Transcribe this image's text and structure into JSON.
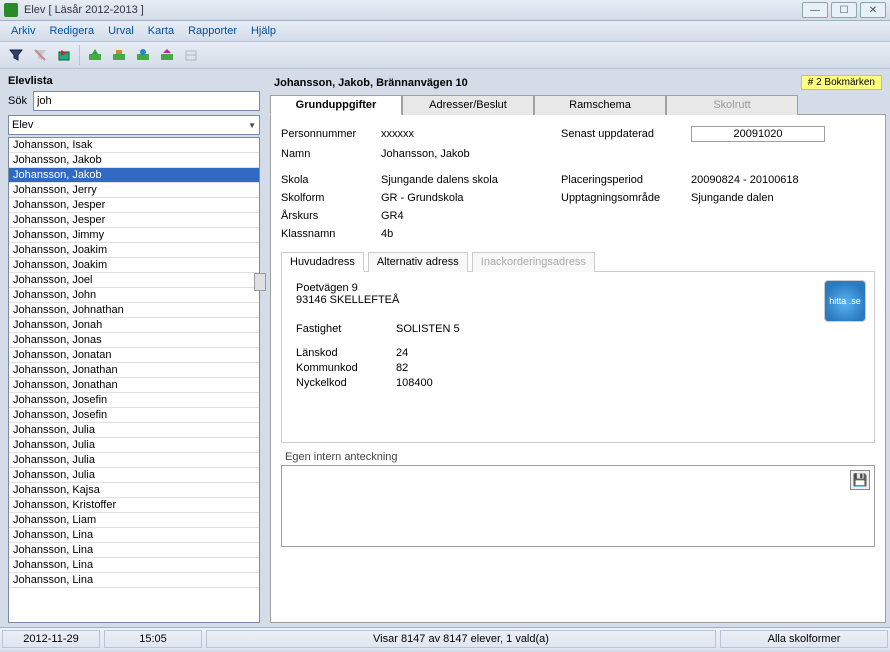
{
  "window": {
    "title": "Elev  [ Läsår 2012-2013 ]"
  },
  "menu": {
    "arkiv": "Arkiv",
    "redigera": "Redigera",
    "urval": "Urval",
    "karta": "Karta",
    "rapporter": "Rapporter",
    "hjalp": "Hjälp"
  },
  "left": {
    "heading": "Elevlista",
    "search_label": "Sök",
    "search_value": "joh",
    "dropdown": "Elev",
    "items": [
      "Johansson, Isak",
      "Johansson, Jakob",
      "Johansson, Jakob",
      "Johansson, Jerry",
      "Johansson, Jesper",
      "Johansson, Jesper",
      "Johansson, Jimmy",
      "Johansson, Joakim",
      "Johansson, Joakim",
      "Johansson, Joel",
      "Johansson, John",
      "Johansson, Johnathan",
      "Johansson, Jonah",
      "Johansson, Jonas",
      "Johansson, Jonatan",
      "Johansson, Jonathan",
      "Johansson, Jonathan",
      "Johansson, Josefin",
      "Johansson, Josefin",
      "Johansson, Julia",
      "Johansson, Julia",
      "Johansson, Julia",
      "Johansson, Julia",
      "Johansson, Kajsa",
      "Johansson, Kristoffer",
      "Johansson, Liam",
      "Johansson, Lina",
      "Johansson, Lina",
      "Johansson, Lina",
      "Johansson, Lina"
    ],
    "selected_index": 2
  },
  "right": {
    "title": "Johansson, Jakob, Brännanvägen 10",
    "bookmark": "# 2 Bokmärken",
    "tabs": {
      "grund": "Grunduppgifter",
      "adr": "Adresser/Beslut",
      "ram": "Ramschema",
      "skol": "Skolrutt"
    },
    "fields": {
      "personnummer_l": "Personnummer",
      "personnummer_v": "xxxxxx",
      "senast_l": "Senast uppdaterad",
      "senast_v": "20091020",
      "namn_l": "Namn",
      "namn_v": "Johansson, Jakob",
      "skola_l": "Skola",
      "skola_v": "Sjungande dalens skola",
      "placering_l": "Placeringsperiod",
      "placering_v": "20090824 - 20100618",
      "skolform_l": "Skolform",
      "skolform_v": "GR - Grundskola",
      "upptag_l": "Upptagningsområde",
      "upptag_v": "Sjungande dalen",
      "arskurs_l": "Årskurs",
      "arskurs_v": "GR4",
      "klass_l": "Klassnamn",
      "klass_v": "4b"
    },
    "subtabs": {
      "huvud": "Huvudadress",
      "alt": "Alternativ adress",
      "inack": "Inackorderingsadress"
    },
    "address": {
      "line1": "Poetvägen 9",
      "line2": "93146 SKELLEFTEÅ",
      "fastighet_l": "Fastighet",
      "fastighet_v": "SOLISTEN 5",
      "lanskod_l": "Länskod",
      "lanskod_v": "24",
      "kommunkod_l": "Kommunkod",
      "kommunkod_v": "82",
      "nyckelkod_l": "Nyckelkod",
      "nyckelkod_v": "108400",
      "hitta": "hitta .se"
    },
    "note_label": "Egen intern anteckning",
    "note_value": ""
  },
  "status": {
    "date": "2012-11-29",
    "time": "15:05",
    "mid": "Visar 8147 av 8147 elever, 1 vald(a)",
    "right": "Alla skolformer"
  }
}
